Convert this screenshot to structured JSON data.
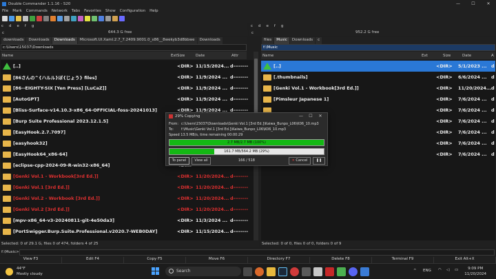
{
  "window": {
    "title": "Double Commander 1.1.16 - S20",
    "min": "—",
    "max": "☐",
    "close": "✕"
  },
  "menu": [
    "File",
    "Mark",
    "Commands",
    "Network",
    "Tabs",
    "Favorites",
    "Show",
    "Configuration",
    "Help"
  ],
  "toolbar_colors": [
    "#d8d8d8",
    "#4c9be8",
    "#e4c04a",
    "#c0c0c0",
    "#40a040",
    "#d04040",
    "#808080",
    "#e08030",
    "#5b9be0",
    "#a0a0a0",
    "#40a0c0",
    "#c060c0",
    "#e0e040",
    "#70c070",
    "#5080e0",
    "#999999",
    "#d0a050",
    "#6a6aff"
  ],
  "left": {
    "drives": [
      "c",
      "d",
      "e",
      "f",
      "g"
    ],
    "drive_current": "c",
    "free": "644.3 G free",
    "tabs": [
      "downloads",
      "Downloads",
      "Downloads",
      "Microsoft.UI.Xaml.2.7_7.2409.9001.0_x86__8wekyb3d8bbwe",
      "Downloads"
    ],
    "active_tab": 2,
    "path": "c:\\Users\\15037\\Downloads",
    "columns": {
      "name": "Name",
      "ext": "Ext",
      "size": "Size",
      "date": "Date",
      "attr": "Attr"
    },
    "rows": [
      {
        "name": "[..]",
        "size": "<DIR>",
        "date": "11/15/2024...",
        "attr": "d--------",
        "up": true,
        "red": false
      },
      {
        "name": "[86さんの^{ハルル}ぼ{じょう} files]",
        "size": "<DIR>",
        "date": "11/9/2024 ...",
        "attr": "d--------",
        "up": false,
        "red": false
      },
      {
        "name": "[86--EIGHTY-SIX [Yen Press] [LuCaZ]]",
        "size": "<DIR>",
        "date": "11/9/2024 ...",
        "attr": "d--------",
        "up": false,
        "red": false
      },
      {
        "name": "[AutoGPT]",
        "size": "<DIR>",
        "date": "11/9/2024 ...",
        "attr": "d--------",
        "up": false,
        "red": false
      },
      {
        "name": "[Bliss-Surface-v14.10.3-x86_64-OFFICIAL-foss-20241013]",
        "size": "<DIR>",
        "date": "11/9/2024 ...",
        "attr": "d--------",
        "up": false,
        "red": false
      },
      {
        "name": "[Burp Suite Professional 2023.12.1.5]",
        "size": "<DIR>",
        "date": "11/14/2024...",
        "attr": "d--------",
        "up": false,
        "red": false
      },
      {
        "name": "[EasyHook.2.7.7097]",
        "size": "<DIR>",
        "date": "",
        "attr": "",
        "up": false,
        "red": false
      },
      {
        "name": "[easyhook32]",
        "size": "<DIR>",
        "date": "",
        "attr": "",
        "up": false,
        "red": false
      },
      {
        "name": "[EasyHook64_x86-64]",
        "size": "<DIR>",
        "date": "",
        "attr": "",
        "up": false,
        "red": false
      },
      {
        "name": "[eclipse-cpp-2024-09-R-win32-x86_64]",
        "size": "<DIR>",
        "date": "",
        "attr": "",
        "up": false,
        "red": false
      },
      {
        "name": "[Genki Vol.1 - Workbook[3rd Ed.]]",
        "size": "<DIR>",
        "date": "11/20/2024...",
        "attr": "d--------",
        "up": false,
        "red": true
      },
      {
        "name": "[Genki Vol.1 [3rd Ed.]]",
        "size": "<DIR>",
        "date": "11/20/2024...",
        "attr": "d--------",
        "up": false,
        "red": true
      },
      {
        "name": "[Genki Vol.2 - Workbook [3rd Ed.]]",
        "size": "<DIR>",
        "date": "11/20/2024...",
        "attr": "d--------",
        "up": false,
        "red": true
      },
      {
        "name": "[Genki Vol.2 [3rd Ed.]]",
        "size": "<DIR>",
        "date": "11/20/2024...",
        "attr": "d--------",
        "up": false,
        "red": true
      },
      {
        "name": "[mpv-x86_64-v3-20240811-git-4e50da3]",
        "size": "<DIR>",
        "date": "11/3/2024 ...",
        "attr": "d--------",
        "up": false,
        "red": false
      },
      {
        "name": "[PortSwigger.Burp.Suite.Professional.v2020.7-WEB0DAY]",
        "size": "<DIR>",
        "date": "11/15/2024...",
        "attr": "d--------",
        "up": false,
        "red": false
      }
    ],
    "status": "Selected: 0 of 29.1 G, files 0 of 474, folders 4 of 25"
  },
  "right": {
    "drives": [
      "c",
      "d",
      "e",
      "f",
      "g"
    ],
    "drive_current": "c",
    "free": "952.2 G free",
    "tabs": [
      "files",
      "Music",
      "Downloads",
      "c"
    ],
    "active_tab": 1,
    "path": "f:\\Music",
    "columns": {
      "name": "Name",
      "ext": "Ext",
      "size": "Size",
      "date": "Date",
      "attr": "A"
    },
    "rows": [
      {
        "name": "[..]",
        "size": "<DIR>",
        "date": "5/1/2023 ...",
        "attr": "d",
        "up": true,
        "sel": true
      },
      {
        "name": "[.thumbnails]",
        "size": "<DIR>",
        "date": "6/6/2024 ...",
        "attr": "d",
        "up": false,
        "sel": false
      },
      {
        "name": "[Genki Vol.1 - Workbook[3rd Ed.]]",
        "size": "<DIR>",
        "date": "11/20/2024...",
        "attr": "d",
        "up": false,
        "sel": false
      },
      {
        "name": "[Pimsleur Japanese 1]",
        "size": "<DIR>",
        "date": "7/6/2024 ...",
        "attr": "d",
        "up": false,
        "sel": false
      },
      {
        "name": "",
        "size": "<DIR>",
        "date": "7/6/2024 ...",
        "attr": "d",
        "up": false,
        "sel": false
      },
      {
        "name": "",
        "size": "<DIR>",
        "date": "7/6/2024 ...",
        "attr": "d",
        "up": false,
        "sel": false
      },
      {
        "name": "",
        "size": "<DIR>",
        "date": "7/6/2024 ...",
        "attr": "d",
        "up": false,
        "sel": false
      },
      {
        "name": "",
        "size": "<DIR>",
        "date": "7/6/2024 ...",
        "attr": "d",
        "up": false,
        "sel": false
      },
      {
        "name": "",
        "size": "<DIR>",
        "date": "7/6/2024 ...",
        "attr": "d",
        "up": false,
        "sel": false
      }
    ],
    "status": "Selected: 0 of 0, files 0 of 0, folders 0 of 9"
  },
  "dialog": {
    "title": "29% Copying",
    "from_label": "From:",
    "from": "c:\\Users\\15037\\Downloads\\Genki Vol.1 [3rd Ed.]\\Kaiwa_Bunpo_L06\\K06_10.mp3",
    "to_label": "To:",
    "to": "f:\\Music\\Genki Vol.1 [3rd Ed.]\\Kaiwa_Bunpo_L06\\K06_10.mp3",
    "speed": "Speed 13.5 MB/s, time remaining 00:00:29",
    "bar1_text": "2.7 MB/2.7 MB (100%)",
    "bar1_fraction": 1.0,
    "bar2_text": "161.7 MB/564.2 MB (29%)",
    "bar2_fraction": 0.29,
    "to_panel": "To panel",
    "view_all": "View all",
    "count": "166 / 518",
    "cancel": "Cancel",
    "pause": "❚❚"
  },
  "cmdline_label": "f:\\Music>",
  "fkeys": [
    "View F3",
    "Edit F4",
    "Copy F5",
    "Move F6",
    "Directory F7",
    "Delete F8",
    "Terminal F9",
    "Exit Alt+X"
  ],
  "taskbar": {
    "weather_temp": "44°F",
    "weather_text": "Mostly cloudy",
    "search": "Search",
    "lang": "ENG",
    "time": "9:09 PM",
    "date": "11/20/2024"
  }
}
